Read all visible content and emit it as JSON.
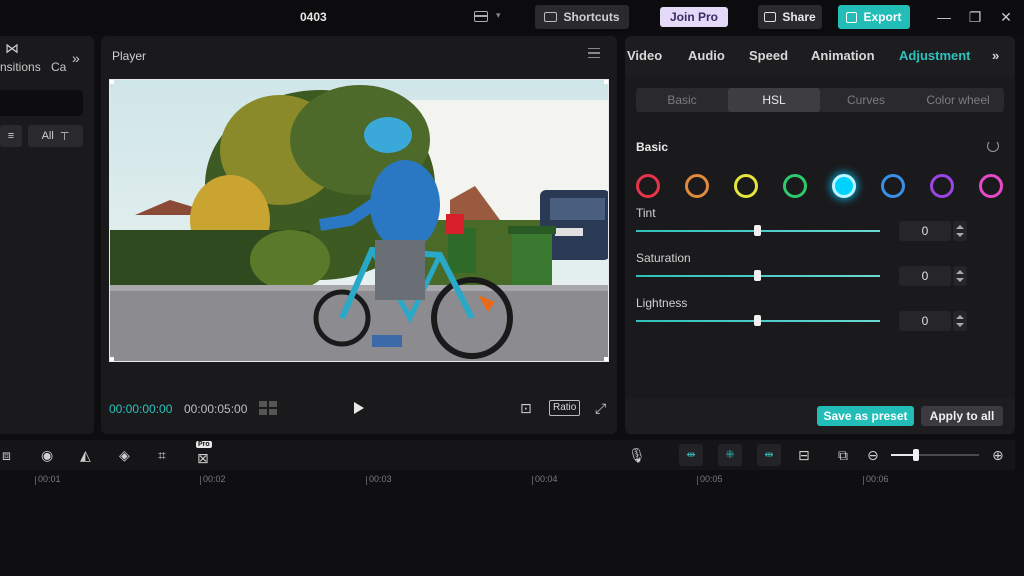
{
  "window": {
    "project_title": "0403",
    "shortcuts_label": "Shortcuts",
    "join_pro_label": "Join Pro",
    "share_label": "Share",
    "export_label": "Export"
  },
  "left_panel": {
    "tab_partial_1": "nsitions",
    "tab_partial_2": "Ca",
    "filter_all_label": "All"
  },
  "player": {
    "title": "Player",
    "current_time": "00:00:00:00",
    "duration": "00:00:05:00",
    "ratio_label": "Ratio"
  },
  "inspector": {
    "tabs": [
      "Video",
      "Audio",
      "Speed",
      "Animation",
      "Adjustment"
    ],
    "active_tab": "Adjustment",
    "subtabs": [
      "Basic",
      "HSL",
      "Curves",
      "Color wheel"
    ],
    "active_subtab": "HSL",
    "section_title": "Basic",
    "hsl_colors": [
      "#e8334a",
      "#e08a3c",
      "#e5e53a",
      "#2fc96b",
      "#00d2ff",
      "#3a8fe6",
      "#9b45e6",
      "#e64ac8"
    ],
    "selected_color_index": 4,
    "sliders": [
      {
        "label": "Tint",
        "value": "0"
      },
      {
        "label": "Saturation",
        "value": "0"
      },
      {
        "label": "Lightness",
        "value": "0"
      }
    ],
    "save_preset_label": "Save as preset",
    "apply_all_label": "Apply to all"
  },
  "timeline": {
    "pro_badge": "Pro",
    "ruler_marks": [
      "00:01",
      "00:02",
      "00:03",
      "00:04",
      "00:05",
      "00:06"
    ]
  },
  "colors": {
    "accent": "#2fc1bc",
    "panel_bg": "#1a1a1d",
    "app_bg": "#0e0e10"
  }
}
